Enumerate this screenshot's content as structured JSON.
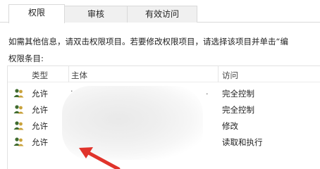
{
  "tabs": [
    {
      "label": "权限",
      "active": true
    },
    {
      "label": "审核",
      "active": false
    },
    {
      "label": "有效访问",
      "active": false
    }
  ],
  "info_text": "如需其他信息，请双击权限项目。若要修改权限项目，请选择该项目并单击“编",
  "list_label": "权限条目:",
  "columns": {
    "type": "类型",
    "principal": "主体",
    "access": "访问"
  },
  "rows": [
    {
      "type": "允许",
      "access": "完全控制"
    },
    {
      "type": "允许",
      "access": "完全控制"
    },
    {
      "type": "允许",
      "access": "修改"
    },
    {
      "type": "允许",
      "access": "读取和执行"
    }
  ],
  "colors": {
    "arrow": "#e0332b",
    "icon_primary": "#3f6b2f",
    "icon_secondary": "#c9a23b"
  }
}
